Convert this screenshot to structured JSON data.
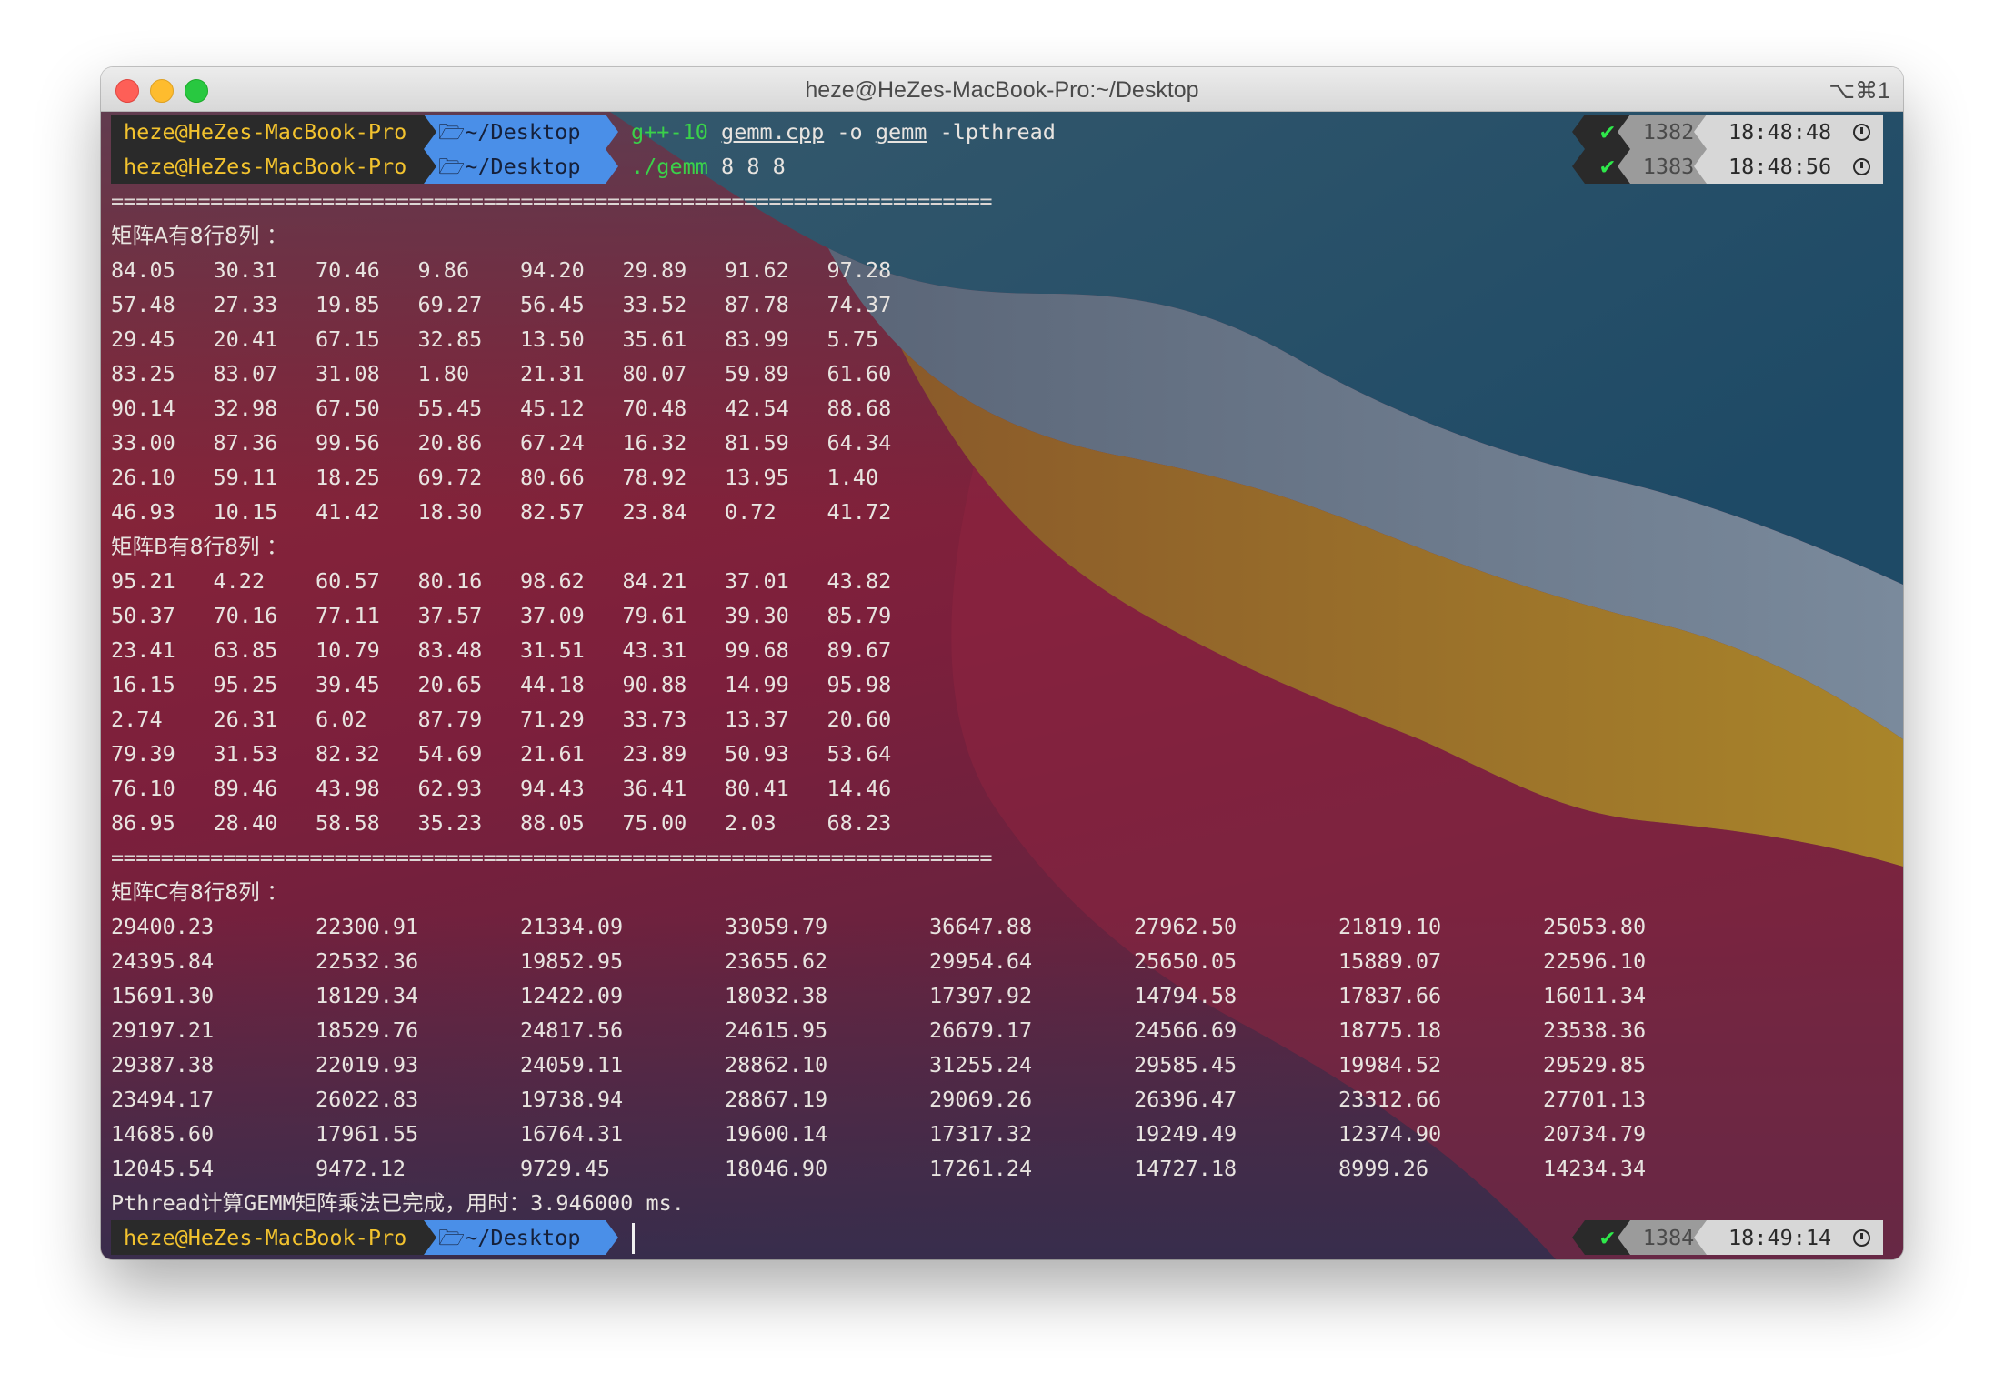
{
  "window": {
    "title": "heze@HeZes-MacBook-Pro:~/Desktop",
    "shortcut": "⌥⌘1"
  },
  "prompt": {
    "user_host": "heze@HeZes-MacBook-Pro",
    "dir": "~/Desktop",
    "folder_icon": "folder-icon"
  },
  "commands": [
    {
      "exe": "g++-10",
      "parts": [
        " ",
        "gemm.cpp",
        " -o ",
        "gemm",
        " -lpthread"
      ],
      "status": "✔",
      "number": "1382",
      "time": "18:48:48"
    },
    {
      "exe": "./gemm",
      "parts": [
        " 8 8 8"
      ],
      "status": "✔",
      "number": "1383",
      "time": "18:48:56"
    }
  ],
  "separator": "=======================================================================",
  "matrix_a": {
    "label": "矩阵A有8行8列 ：",
    "rows": [
      [
        "84.05",
        "30.31",
        "70.46",
        "9.86",
        "94.20",
        "29.89",
        "91.62",
        "97.28"
      ],
      [
        "57.48",
        "27.33",
        "19.85",
        "69.27",
        "56.45",
        "33.52",
        "87.78",
        "74.37"
      ],
      [
        "29.45",
        "20.41",
        "67.15",
        "32.85",
        "13.50",
        "35.61",
        "83.99",
        "5.75"
      ],
      [
        "83.25",
        "83.07",
        "31.08",
        "1.80",
        "21.31",
        "80.07",
        "59.89",
        "61.60"
      ],
      [
        "90.14",
        "32.98",
        "67.50",
        "55.45",
        "45.12",
        "70.48",
        "42.54",
        "88.68"
      ],
      [
        "33.00",
        "87.36",
        "99.56",
        "20.86",
        "67.24",
        "16.32",
        "81.59",
        "64.34"
      ],
      [
        "26.10",
        "59.11",
        "18.25",
        "69.72",
        "80.66",
        "78.92",
        "13.95",
        "1.40"
      ],
      [
        "46.93",
        "10.15",
        "41.42",
        "18.30",
        "82.57",
        "23.84",
        "0.72",
        "41.72"
      ]
    ]
  },
  "matrix_b": {
    "label": "矩阵B有8行8列 ：",
    "rows": [
      [
        "95.21",
        "4.22",
        "60.57",
        "80.16",
        "98.62",
        "84.21",
        "37.01",
        "43.82"
      ],
      [
        "50.37",
        "70.16",
        "77.11",
        "37.57",
        "37.09",
        "79.61",
        "39.30",
        "85.79"
      ],
      [
        "23.41",
        "63.85",
        "10.79",
        "83.48",
        "31.51",
        "43.31",
        "99.68",
        "89.67"
      ],
      [
        "16.15",
        "95.25",
        "39.45",
        "20.65",
        "44.18",
        "90.88",
        "14.99",
        "95.98"
      ],
      [
        "2.74",
        "26.31",
        "6.02",
        "87.79",
        "71.29",
        "33.73",
        "13.37",
        "20.60"
      ],
      [
        "79.39",
        "31.53",
        "82.32",
        "54.69",
        "21.61",
        "23.89",
        "50.93",
        "53.64"
      ],
      [
        "76.10",
        "89.46",
        "43.98",
        "62.93",
        "94.43",
        "36.41",
        "80.41",
        "14.46"
      ],
      [
        "86.95",
        "28.40",
        "58.58",
        "35.23",
        "88.05",
        "75.00",
        "2.03",
        "68.23"
      ]
    ]
  },
  "matrix_c": {
    "label": "矩阵C有8行8列 ：",
    "rows": [
      [
        "29400.23",
        "22300.91",
        "21334.09",
        "33059.79",
        "36647.88",
        "27962.50",
        "21819.10",
        "25053.80"
      ],
      [
        "24395.84",
        "22532.36",
        "19852.95",
        "23655.62",
        "29954.64",
        "25650.05",
        "15889.07",
        "22596.10"
      ],
      [
        "15691.30",
        "18129.34",
        "12422.09",
        "18032.38",
        "17397.92",
        "14794.58",
        "17837.66",
        "16011.34"
      ],
      [
        "29197.21",
        "18529.76",
        "24817.56",
        "24615.95",
        "26679.17",
        "24566.69",
        "18775.18",
        "23538.36"
      ],
      [
        "29387.38",
        "22019.93",
        "24059.11",
        "28862.10",
        "31255.24",
        "29585.45",
        "19984.52",
        "29529.85"
      ],
      [
        "23494.17",
        "26022.83",
        "19738.94",
        "28867.19",
        "29069.26",
        "26396.47",
        "23312.66",
        "27701.13"
      ],
      [
        "14685.60",
        "17961.55",
        "16764.31",
        "19600.14",
        "17317.32",
        "19249.49",
        "12374.90",
        "20734.79"
      ],
      [
        "12045.54",
        "9472.12",
        "9729.45",
        "18046.90",
        "17261.24",
        "14727.18",
        "8999.26",
        "14234.34"
      ]
    ]
  },
  "result": "Pthread计算GEMM矩阵乘法已完成，用时：3.946000 ms.",
  "last_prompt": {
    "status": "✔",
    "number": "1384",
    "time": "18:49:14"
  },
  "colors": {
    "user_fg": "#f2c22e",
    "dir_bg": "#4a8fe8",
    "command_green": "#3ad14a",
    "status_ok": "#2ee84a"
  }
}
